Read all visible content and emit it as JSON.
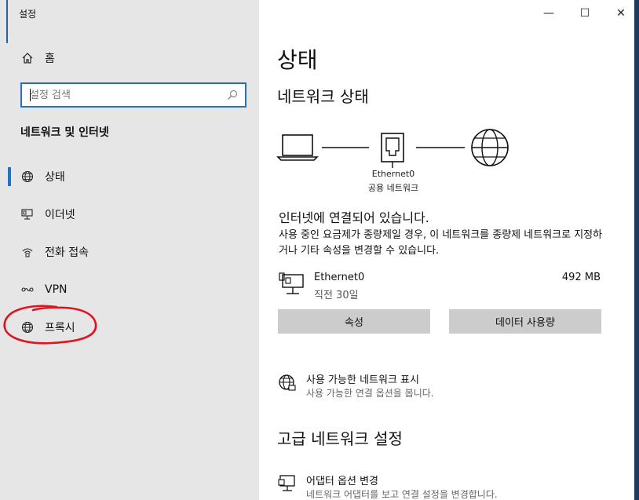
{
  "window": {
    "title": "설정",
    "controls": {
      "minimize": "—",
      "maximize": "☐",
      "close": "✕"
    }
  },
  "sidebar": {
    "home_label": "홈",
    "search_placeholder": "설정 검색",
    "section_heading": "네트워크 및 인터넷",
    "items": [
      {
        "label": "상태",
        "icon": "globe-icon",
        "active": true
      },
      {
        "label": "이더넷",
        "icon": "ethernet-icon",
        "active": false
      },
      {
        "label": "전화 접속",
        "icon": "dialup-icon",
        "active": false
      },
      {
        "label": "VPN",
        "icon": "vpn-icon",
        "active": false
      },
      {
        "label": "프록시",
        "icon": "globe-icon",
        "active": false,
        "circled": true
      }
    ],
    "annotation_color": "#e0131e",
    "accent_color": "#1e72c8"
  },
  "main": {
    "title": "상태",
    "network_status_heading": "네트워크 상태",
    "diagram": {
      "adapter_name": "Ethernet0",
      "network_type": "공용 네트워크"
    },
    "status_title": "인터넷에 연결되어 있습니다.",
    "status_desc": "사용 중인 요금제가 종량제일 경우, 이 네트워크를 종량제 네트워크로 지정하거나 기타 속성을 변경할 수 있습니다.",
    "adapter": {
      "name": "Ethernet0",
      "time": "직전 30일",
      "usage": "492 MB"
    },
    "buttons": {
      "properties": "속성",
      "data_usage": "데이터 사용량"
    },
    "show_networks": {
      "title": "사용 가능한 네트워크 표시",
      "desc": "사용 가능한 연결 옵션을 봅니다."
    },
    "advanced_heading": "고급 네트워크 설정",
    "adapter_options": {
      "title": "어댑터 옵션 변경",
      "desc": "네트워크 어댑터를 보고 연결 설정을 변경합니다."
    }
  }
}
